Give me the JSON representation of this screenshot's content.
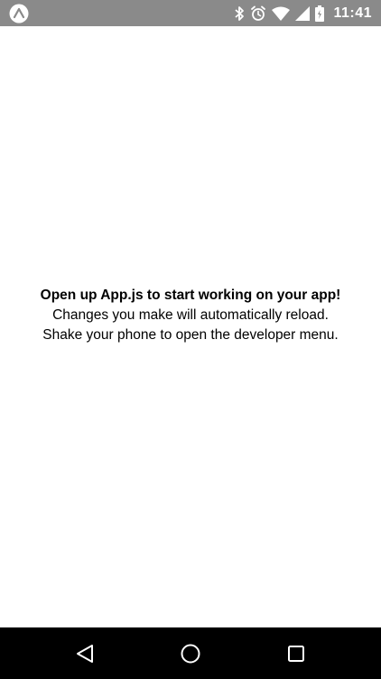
{
  "status_bar": {
    "time": "11:41",
    "icons": [
      "expo-logo-icon",
      "bluetooth-icon",
      "alarm-icon",
      "wifi-icon",
      "signal-icon",
      "battery-icon"
    ]
  },
  "main": {
    "lines": [
      "Open up App.js to start working on your app!",
      "Changes you make will automatically reload.",
      "Shake your phone to open the developer menu."
    ]
  },
  "nav_bar": {
    "buttons": [
      "back-icon",
      "home-icon",
      "recents-icon"
    ]
  },
  "colors": {
    "status_bar_bg": "#8a8a8a",
    "content_bg": "#ffffff",
    "nav_bar_bg": "#000000",
    "text": "#000000"
  }
}
